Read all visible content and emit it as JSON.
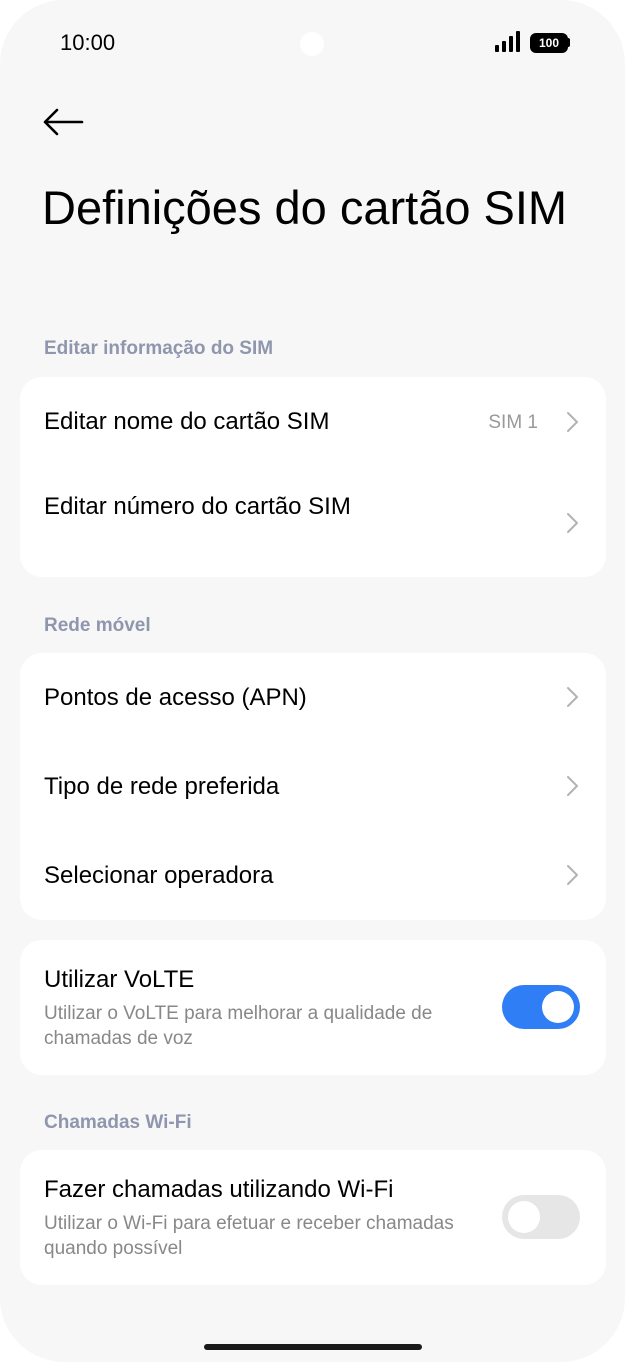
{
  "status": {
    "time": "10:00",
    "battery": "100",
    "icons": [
      "signal-icon",
      "battery-icon"
    ]
  },
  "header": {
    "back_icon": "arrow-left-icon",
    "title": "Definições do cartão SIM"
  },
  "sections": {
    "sim_info": {
      "label": "Editar informação do SIM",
      "items": [
        {
          "title": "Editar nome do cartão SIM",
          "value": "SIM 1"
        },
        {
          "title": "Editar número do cartão SIM"
        }
      ]
    },
    "mobile_network": {
      "label": "Rede móvel",
      "items": [
        {
          "title": "Pontos de acesso (APN)"
        },
        {
          "title": "Tipo de rede preferida"
        },
        {
          "title": "Selecionar operadora"
        }
      ]
    },
    "volte": {
      "title": "Utilizar VoLTE",
      "subtitle": "Utilizar o VoLTE para melhorar a qualidade de chamadas de voz",
      "enabled": true
    },
    "wifi_calls": {
      "label": "Chamadas Wi-Fi",
      "title": "Fazer chamadas utilizando Wi-Fi",
      "subtitle": "Utilizar o Wi-Fi para efetuar e receber chamadas quando possível",
      "enabled": false
    }
  },
  "colors": {
    "toggle_on": "#2f7ef5",
    "toggle_off": "#e6e6e6",
    "section_label": "#8f96ad",
    "background": "#f7f7f7"
  }
}
